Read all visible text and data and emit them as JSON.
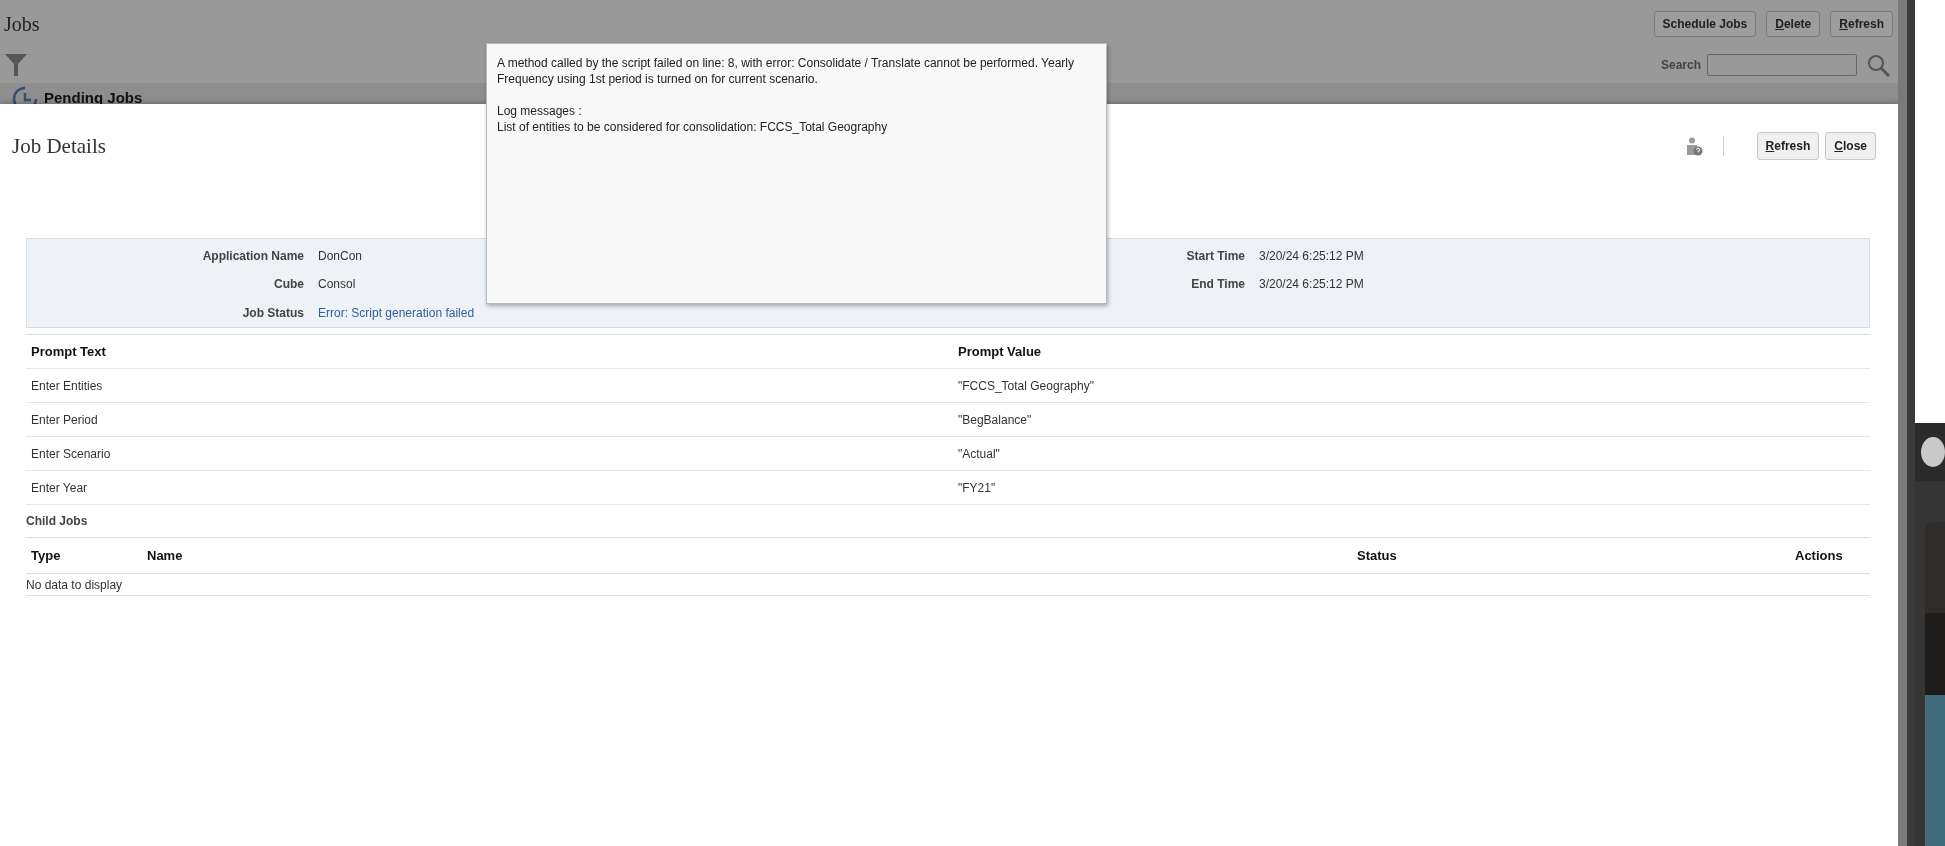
{
  "page": {
    "title": "Jobs",
    "buttons": [
      {
        "label": "Schedule Jobs",
        "access_key": false
      },
      {
        "label": "Delete",
        "access_key": true
      },
      {
        "label": "Refresh",
        "access_key": true
      }
    ],
    "search": {
      "label": "Search"
    },
    "section": "Pending Jobs"
  },
  "dialog": {
    "title": "Job Details",
    "buttons": [
      {
        "label": "Refresh",
        "access_key": true
      },
      {
        "label": "Close",
        "access_key": true
      }
    ],
    "details": {
      "left": [
        {
          "label": "Application Name",
          "value": "DonCon",
          "kind": "text"
        },
        {
          "label": "Cube",
          "value": "Consol",
          "kind": "text"
        },
        {
          "label": "Job Status",
          "value": "Error: Script generation failed",
          "kind": "link"
        }
      ],
      "right": [
        {
          "label": "Start Time",
          "value": "3/20/24 6:25:12 PM",
          "kind": "text"
        },
        {
          "label": "End Time",
          "value": "3/20/24 6:25:12 PM",
          "kind": "text"
        }
      ]
    },
    "prompts": {
      "columns": [
        "Prompt Text",
        "Prompt Value"
      ],
      "rows": [
        [
          "Enter Entities",
          "\"FCCS_Total Geography\""
        ],
        [
          "Enter Period",
          "\"BegBalance\""
        ],
        [
          "Enter Scenario",
          "\"Actual\""
        ],
        [
          "Enter Year",
          "\"FY21\""
        ]
      ]
    },
    "child_jobs": {
      "title": "Child Jobs",
      "columns": [
        "Type",
        "Name",
        "Status",
        "Actions"
      ],
      "empty_text": "No data to display"
    }
  },
  "tooltip": {
    "message": "A method called by the script failed on line: 8, with error: Consolidate / Translate cannot be performed. Yearly Frequency using 1st period is turned on for current scenario.",
    "log_title": "Log messages :",
    "log_lines": [
      "List of entities to be considered for consolidation: FCCS_Total Geography"
    ]
  }
}
